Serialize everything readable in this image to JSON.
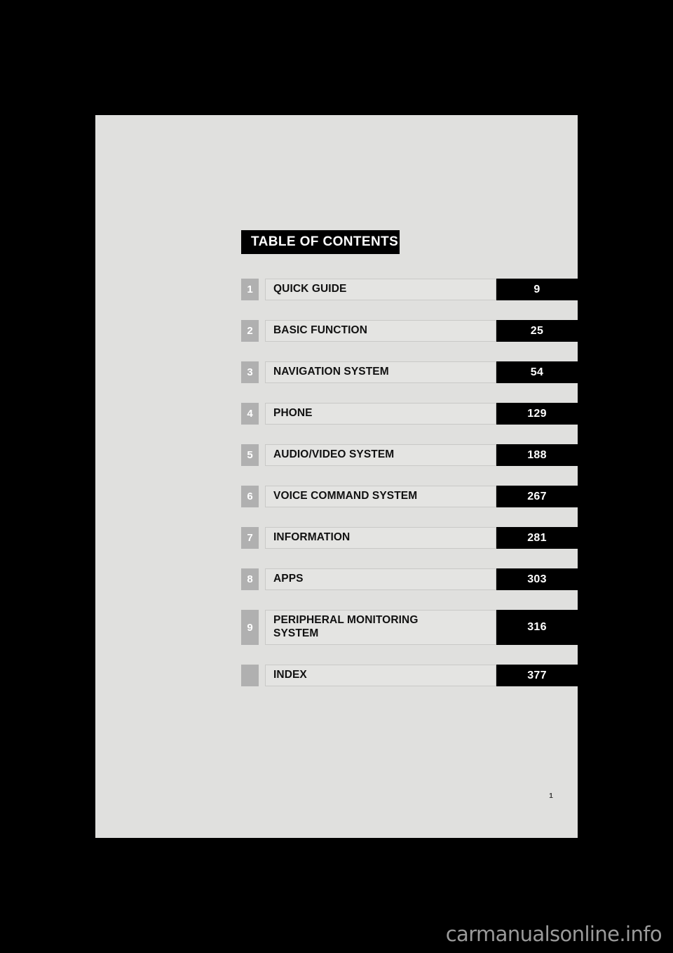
{
  "document": {
    "banner_title": "TABLE OF CONTENTS",
    "folio": "1",
    "watermark": "carmanualsonline.info",
    "colors": {
      "page_background": "#e0e0de",
      "outer_background": "#000000",
      "chip": "#b0b0b0",
      "label_plate": "#e4e4e2",
      "label_border": "#c9c9c7",
      "page_number_plate": "#000000",
      "text": "#111111",
      "watermark": "#9a9a9a"
    }
  },
  "contents": [
    {
      "number": "1",
      "title": "QUICK GUIDE",
      "page": "9"
    },
    {
      "number": "2",
      "title": "BASIC FUNCTION",
      "page": "25"
    },
    {
      "number": "3",
      "title": "NAVIGATION SYSTEM",
      "page": "54"
    },
    {
      "number": "4",
      "title": "PHONE",
      "page": "129"
    },
    {
      "number": "5",
      "title": "AUDIO/VIDEO SYSTEM",
      "page": "188"
    },
    {
      "number": "6",
      "title": "VOICE COMMAND SYSTEM",
      "page": "267"
    },
    {
      "number": "7",
      "title": "INFORMATION",
      "page": "281"
    },
    {
      "number": "8",
      "title": "APPS",
      "page": "303"
    },
    {
      "number": "9",
      "title": "PERIPHERAL MONITORING\nSYSTEM",
      "page": "316"
    },
    {
      "number": "",
      "title": "INDEX",
      "page": "377"
    }
  ]
}
